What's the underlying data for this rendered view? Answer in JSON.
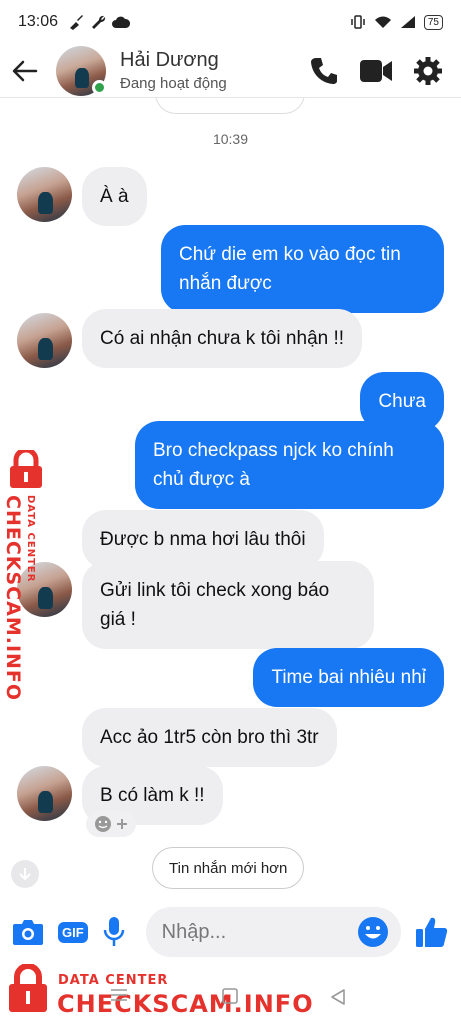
{
  "status_bar": {
    "time": "13:06",
    "battery": "75"
  },
  "header": {
    "contact_name": "Hải Dương",
    "contact_status": "Đang hoạt động"
  },
  "chat": {
    "timestamp": "10:39",
    "newer_button": "Tin nhắn mới hơn",
    "messages": [
      {
        "dir": "in",
        "text": "À à"
      },
      {
        "dir": "out",
        "line1": "Chứ die em ko vào đọc tin",
        "line2": "nhắn được"
      },
      {
        "dir": "in",
        "text": "Có ai nhận chưa k tôi nhận !!"
      },
      {
        "dir": "out",
        "text": "Chưa"
      },
      {
        "dir": "out",
        "line1": "Bro checkpass njck ko chính",
        "line2": "chủ được à"
      },
      {
        "dir": "in",
        "text": "Được b nma hơi lâu thôi"
      },
      {
        "dir": "in",
        "line1": "Gửi link tôi check xong báo",
        "line2": "giá !"
      },
      {
        "dir": "out",
        "text": "Time bai nhiêu nhỉ"
      },
      {
        "dir": "in",
        "text": "Acc ảo 1tr5 còn bro thì 3tr"
      },
      {
        "dir": "in",
        "text": "B có làm k !!"
      }
    ]
  },
  "composer": {
    "placeholder": "Nhập...",
    "gif_label": "GIF"
  },
  "watermark": {
    "small": "DATA CENTER",
    "brand": "CHECKSCAM.INFO"
  },
  "colors": {
    "accent": "#1877f2",
    "online": "#31a24c",
    "watermark": "#e5322d"
  }
}
